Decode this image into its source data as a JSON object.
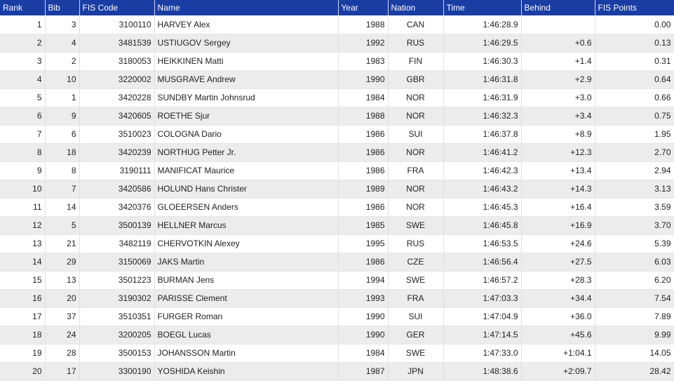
{
  "table": {
    "headers": {
      "rank": "Rank",
      "bib": "Bib",
      "fis_code": "FIS Code",
      "name": "Name",
      "year": "Year",
      "nation": "Nation",
      "time": "Time",
      "behind": "Behind",
      "fis_points": "FIS Points"
    },
    "rows": [
      {
        "rank": "1",
        "bib": "3",
        "fis_code": "3100110",
        "name": "HARVEY Alex",
        "year": "1988",
        "nation": "CAN",
        "time": "1:46:28.9",
        "behind": "",
        "fis_points": "0.00"
      },
      {
        "rank": "2",
        "bib": "4",
        "fis_code": "3481539",
        "name": "USTIUGOV Sergey",
        "year": "1992",
        "nation": "RUS",
        "time": "1:46:29.5",
        "behind": "+0.6",
        "fis_points": "0.13"
      },
      {
        "rank": "3",
        "bib": "2",
        "fis_code": "3180053",
        "name": "HEIKKINEN Matti",
        "year": "1983",
        "nation": "FIN",
        "time": "1:46:30.3",
        "behind": "+1.4",
        "fis_points": "0.31"
      },
      {
        "rank": "4",
        "bib": "10",
        "fis_code": "3220002",
        "name": "MUSGRAVE Andrew",
        "year": "1990",
        "nation": "GBR",
        "time": "1:46:31.8",
        "behind": "+2.9",
        "fis_points": "0.64"
      },
      {
        "rank": "5",
        "bib": "1",
        "fis_code": "3420228",
        "name": "SUNDBY Martin Johnsrud",
        "year": "1984",
        "nation": "NOR",
        "time": "1:46:31.9",
        "behind": "+3.0",
        "fis_points": "0.66"
      },
      {
        "rank": "6",
        "bib": "9",
        "fis_code": "3420605",
        "name": "ROETHE Sjur",
        "year": "1988",
        "nation": "NOR",
        "time": "1:46:32.3",
        "behind": "+3.4",
        "fis_points": "0.75"
      },
      {
        "rank": "7",
        "bib": "6",
        "fis_code": "3510023",
        "name": "COLOGNA Dario",
        "year": "1986",
        "nation": "SUI",
        "time": "1:46:37.8",
        "behind": "+8.9",
        "fis_points": "1.95"
      },
      {
        "rank": "8",
        "bib": "18",
        "fis_code": "3420239",
        "name": "NORTHUG Petter Jr.",
        "year": "1986",
        "nation": "NOR",
        "time": "1:46:41.2",
        "behind": "+12.3",
        "fis_points": "2.70"
      },
      {
        "rank": "9",
        "bib": "8",
        "fis_code": "3190111",
        "name": "MANIFICAT Maurice",
        "year": "1986",
        "nation": "FRA",
        "time": "1:46:42.3",
        "behind": "+13.4",
        "fis_points": "2.94"
      },
      {
        "rank": "10",
        "bib": "7",
        "fis_code": "3420586",
        "name": "HOLUND Hans Christer",
        "year": "1989",
        "nation": "NOR",
        "time": "1:46:43.2",
        "behind": "+14.3",
        "fis_points": "3.13"
      },
      {
        "rank": "11",
        "bib": "14",
        "fis_code": "3420376",
        "name": "GLOEERSEN Anders",
        "year": "1986",
        "nation": "NOR",
        "time": "1:46:45.3",
        "behind": "+16.4",
        "fis_points": "3.59"
      },
      {
        "rank": "12",
        "bib": "5",
        "fis_code": "3500139",
        "name": "HELLNER Marcus",
        "year": "1985",
        "nation": "SWE",
        "time": "1:46:45.8",
        "behind": "+16.9",
        "fis_points": "3.70"
      },
      {
        "rank": "13",
        "bib": "21",
        "fis_code": "3482119",
        "name": "CHERVOTKIN Alexey",
        "year": "1995",
        "nation": "RUS",
        "time": "1:46:53.5",
        "behind": "+24.6",
        "fis_points": "5.39"
      },
      {
        "rank": "14",
        "bib": "29",
        "fis_code": "3150069",
        "name": "JAKS Martin",
        "year": "1986",
        "nation": "CZE",
        "time": "1:46:56.4",
        "behind": "+27.5",
        "fis_points": "6.03"
      },
      {
        "rank": "15",
        "bib": "13",
        "fis_code": "3501223",
        "name": "BURMAN Jens",
        "year": "1994",
        "nation": "SWE",
        "time": "1:46:57.2",
        "behind": "+28.3",
        "fis_points": "6.20"
      },
      {
        "rank": "16",
        "bib": "20",
        "fis_code": "3190302",
        "name": "PARISSE Clement",
        "year": "1993",
        "nation": "FRA",
        "time": "1:47:03.3",
        "behind": "+34.4",
        "fis_points": "7.54"
      },
      {
        "rank": "17",
        "bib": "37",
        "fis_code": "3510351",
        "name": "FURGER Roman",
        "year": "1990",
        "nation": "SUI",
        "time": "1:47:04.9",
        "behind": "+36.0",
        "fis_points": "7.89"
      },
      {
        "rank": "18",
        "bib": "24",
        "fis_code": "3200205",
        "name": "BOEGL Lucas",
        "year": "1990",
        "nation": "GER",
        "time": "1:47:14.5",
        "behind": "+45.6",
        "fis_points": "9.99"
      },
      {
        "rank": "19",
        "bib": "28",
        "fis_code": "3500153",
        "name": "JOHANSSON Martin",
        "year": "1984",
        "nation": "SWE",
        "time": "1:47:33.0",
        "behind": "+1:04.1",
        "fis_points": "14.05"
      },
      {
        "rank": "20",
        "bib": "17",
        "fis_code": "3300190",
        "name": "YOSHIDA Keishin",
        "year": "1987",
        "nation": "JPN",
        "time": "1:48:38.6",
        "behind": "+2:09.7",
        "fis_points": "28.42"
      }
    ]
  }
}
